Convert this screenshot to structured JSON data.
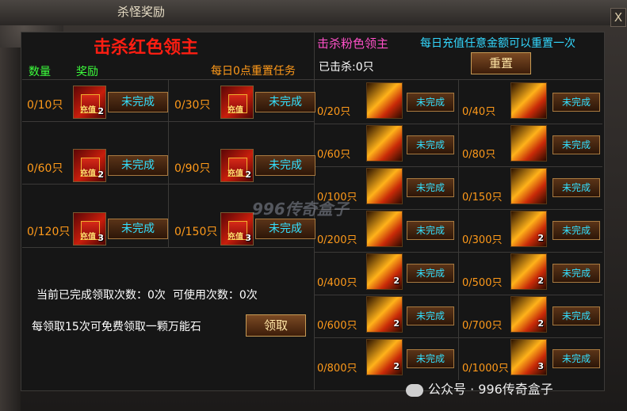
{
  "window": {
    "title": "杀怪奖励",
    "close_label": "X"
  },
  "left": {
    "heading": "击杀红色领主",
    "col_qty": "数量",
    "col_reward": "奖励",
    "daily_reset": "每日0点重置任务",
    "rows": [
      {
        "qty": "0/10只",
        "count": "2",
        "item_tag": "充值",
        "status": "未完成"
      },
      {
        "qty": "0/30只",
        "count": "",
        "item_tag": "充值",
        "status": "未完成"
      },
      {
        "qty": "0/60只",
        "count": "2",
        "item_tag": "充值",
        "status": "未完成"
      },
      {
        "qty": "0/90只",
        "count": "2",
        "item_tag": "充值",
        "status": "未完成"
      },
      {
        "qty": "0/120只",
        "count": "3",
        "item_tag": "充值",
        "status": "未完成"
      },
      {
        "qty": "0/150只",
        "count": "3",
        "item_tag": "充值",
        "status": "未完成"
      }
    ],
    "completed_text": "当前已完成领取次数：0次",
    "usable_text": "可使用次数：0次",
    "bonus_text": "每领取15次可免费领取一颗万能石",
    "claim_label": "领取"
  },
  "right": {
    "heading": "击杀粉色领主",
    "recharge_note": "每日充值任意金额可以重置一次",
    "killed": "已击杀:0只",
    "reset_label": "重置",
    "rows": [
      {
        "qty": "0/20只",
        "count": "",
        "status": "未完成"
      },
      {
        "qty": "0/40只",
        "count": "",
        "status": "未完成"
      },
      {
        "qty": "0/60只",
        "count": "",
        "status": "未完成"
      },
      {
        "qty": "0/80只",
        "count": "",
        "status": "未完成"
      },
      {
        "qty": "0/100只",
        "count": "",
        "status": "未完成"
      },
      {
        "qty": "0/150只",
        "count": "",
        "status": "未完成"
      },
      {
        "qty": "0/200只",
        "count": "",
        "status": "未完成"
      },
      {
        "qty": "0/300只",
        "count": "2",
        "status": "未完成"
      },
      {
        "qty": "0/400只",
        "count": "2",
        "status": "未完成"
      },
      {
        "qty": "0/500只",
        "count": "2",
        "status": "未完成"
      },
      {
        "qty": "0/600只",
        "count": "2",
        "status": "未完成"
      },
      {
        "qty": "0/700只",
        "count": "2",
        "status": "未完成"
      },
      {
        "qty": "0/800只",
        "count": "2",
        "status": "未完成"
      },
      {
        "qty": "0/1000只",
        "count": "3",
        "status": "未完成"
      }
    ]
  },
  "watermark": "996传奇盒子",
  "wechat_caption": "公众号 · 996传奇盒子"
}
